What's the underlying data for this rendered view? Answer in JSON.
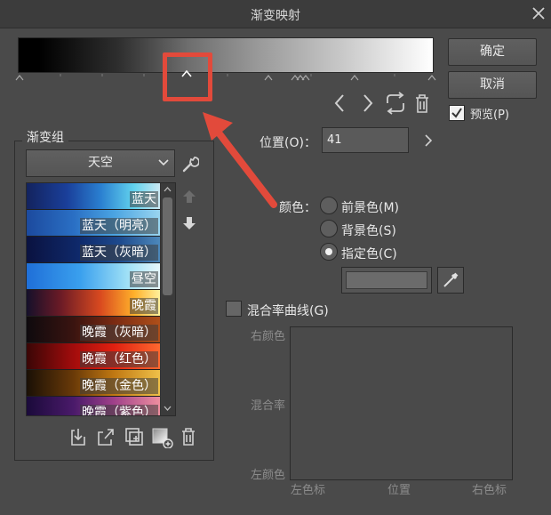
{
  "window": {
    "title": "渐变映射"
  },
  "buttons": {
    "ok": "确定",
    "cancel": "取消"
  },
  "preview": {
    "label": "预览(P)",
    "checked": true
  },
  "position": {
    "label": "位置(O)：",
    "value": "41"
  },
  "color": {
    "label": "颜色：",
    "options": [
      {
        "label": "前景色(M)",
        "selected": false
      },
      {
        "label": "背景色(S)",
        "selected": false
      },
      {
        "label": "指定色(C)",
        "selected": true
      }
    ],
    "swatch": "#6b6b6b"
  },
  "curve": {
    "checkbox_label": "混合率曲线(G)",
    "y_top": "右颜色",
    "y_mid": "混合率",
    "y_bottom": "左颜色",
    "x_left": "左色标",
    "x_mid": "位置",
    "x_right": "右色标"
  },
  "gradient_set": {
    "title": "渐变组",
    "selected": "天空",
    "items": [
      {
        "label": "蓝天"
      },
      {
        "label": "蓝天（明亮）"
      },
      {
        "label": "蓝天（灰暗）"
      },
      {
        "label": "昼空"
      },
      {
        "label": "晚霞"
      },
      {
        "label": "晚霞（灰暗）"
      },
      {
        "label": "晚霞（红色）"
      },
      {
        "label": "晚霞（金色）"
      },
      {
        "label": "晚霞（紫色）"
      }
    ]
  },
  "colors": {
    "accent": "#e24a3b",
    "bg": "#4a4a4a"
  }
}
